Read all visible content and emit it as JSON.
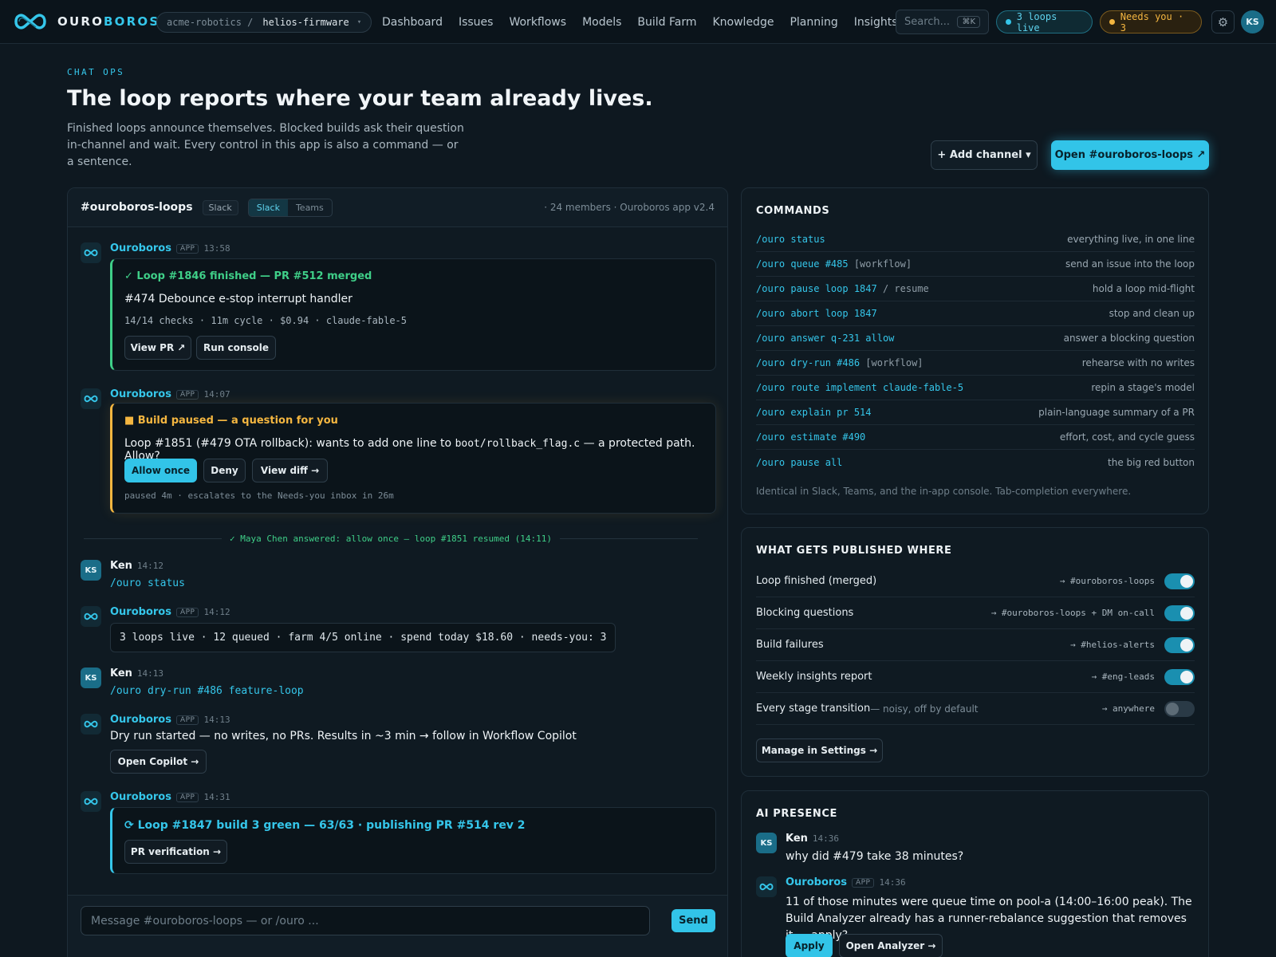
{
  "topbar": {
    "brand_a": "OURO",
    "brand_b": "BOROS",
    "repo_org": "acme-robotics /",
    "repo_name": "helios-firmware",
    "nav": [
      "Dashboard",
      "Issues",
      "Workflows",
      "Models",
      "Build Farm",
      "Knowledge",
      "Planning",
      "Insights"
    ],
    "search_placeholder": "Search...",
    "search_kbd": "⌘K",
    "live_pill": "3 loops live",
    "needs_pill": "Needs you · 3",
    "gear": "⚙",
    "avatar": "KS"
  },
  "hero": {
    "eyebrow": "CHAT OPS",
    "title": "The loop reports where your team already lives.",
    "description": "Finished loops announce themselves. Blocked builds ask their question in-channel and wait. Every control in this app is also a command — or a sentence.",
    "add_channel": "+ Add channel ▾",
    "open_channel": "Open #ouroboros-loops ↗"
  },
  "chat": {
    "channel": "#ouroboros-loops",
    "platform_tag": "Slack",
    "seg": [
      "Slack",
      "Teams"
    ],
    "meta": "· 24 members · Ouroboros app v2.4",
    "app_name": "Ouroboros",
    "app_tag": "APP",
    "messages": [
      {
        "time": "13:58",
        "title": "✓ Loop #1846 finished — PR #512 merged",
        "line1": "#474 Debounce e-stop interrupt handler",
        "line2": "14/14 checks · 11m cycle · $0.94 · claude-fable-5",
        "btn1": "View PR ↗",
        "btn2": "Run console"
      },
      {
        "time": "14:07",
        "title": "■ Build paused — a question for you",
        "body_a": "Loop #1851 (#479 OTA rollback): wants to add one line to ",
        "body_code": "boot/rollback_flag.c",
        "body_b": " — a protected path. Allow?",
        "btn1": "Allow once",
        "btn2": "Deny",
        "btn3": "View diff →",
        "foot": "paused 4m · escalates to the Needs-you inbox in 26m"
      },
      {
        "note": "✓ Maya Chen answered: allow once — loop #1851 resumed (14:11)"
      },
      {
        "sender": "Ken",
        "avatar": "KS",
        "time": "14:12",
        "text": "/ouro status"
      },
      {
        "time": "14:12",
        "text": "3 loops live · 12 queued · farm 4/5 online · spend today $18.60 · needs-you: 3"
      },
      {
        "sender": "Ken",
        "avatar": "KS",
        "time": "14:13",
        "text": "/ouro dry-run #486 feature-loop"
      },
      {
        "time": "14:13",
        "text": "Dry run started — no writes, no PRs. Results in ~3 min → follow in Workflow Copilot",
        "btn1": "Open Copilot →"
      },
      {
        "time": "14:31",
        "title": "⟳ Loop #1847 build 3 green — 63/63 · publishing PR #514 rev 2",
        "btn1": "PR verification →"
      }
    ],
    "compose_placeholder": "Message #ouroboros-loops — or /ouro ...",
    "send": "Send"
  },
  "commands": {
    "title": "COMMANDS",
    "rows": [
      {
        "cmd": "/ouro status",
        "arg": "",
        "desc": "everything live, in one line"
      },
      {
        "cmd": "/ouro queue #485 ",
        "arg": "[workflow]",
        "desc": "send an issue into the loop"
      },
      {
        "cmd": "/ouro pause loop 1847 ",
        "arg": "/ resume",
        "desc": "hold a loop mid-flight"
      },
      {
        "cmd": "/ouro abort loop 1847",
        "arg": "",
        "desc": "stop and clean up"
      },
      {
        "cmd": "/ouro answer q-231 allow",
        "arg": "",
        "desc": "answer a blocking question"
      },
      {
        "cmd": "/ouro dry-run #486 ",
        "arg": "[workflow]",
        "desc": "rehearse with no writes"
      },
      {
        "cmd": "/ouro route implement claude-fable-5",
        "arg": "",
        "desc": "repin a stage's model"
      },
      {
        "cmd": "/ouro explain pr 514",
        "arg": "",
        "desc": "plain-language summary of a PR"
      },
      {
        "cmd": "/ouro estimate #490",
        "arg": "",
        "desc": "effort, cost, and cycle guess"
      },
      {
        "cmd": "/ouro pause all",
        "arg": "",
        "desc": "the big red button"
      }
    ],
    "footnote": "Identical in Slack, Teams, and the in-app console. Tab-completion everywhere."
  },
  "publish": {
    "title": "WHAT GETS PUBLISHED WHERE",
    "rows": [
      {
        "label": "Loop finished (merged)",
        "note": "",
        "dest": "→ #ouroboros-loops",
        "on": true
      },
      {
        "label": "Blocking questions",
        "note": "",
        "dest": "→ #ouroboros-loops + DM on-call",
        "on": true
      },
      {
        "label": "Build failures",
        "note": "",
        "dest": "→ #helios-alerts",
        "on": true
      },
      {
        "label": "Weekly insights report",
        "note": "",
        "dest": "→ #eng-leads",
        "on": true
      },
      {
        "label": "Every stage transition",
        "note": " — noisy, off by default",
        "dest": "→ anywhere",
        "on": false
      }
    ],
    "manage": "Manage in Settings →"
  },
  "presence": {
    "title": "AI PRESENCE",
    "q_sender": "Ken",
    "q_avatar": "KS",
    "q_time": "14:36",
    "q_text": "why did #479 take 38 minutes?",
    "a_time": "14:36",
    "a_text": "11 of those minutes were queue time on pool-a (14:00–16:00 peak). The Build Analyzer already has a runner-rebalance suggestion that removes it — apply?",
    "btn_apply": "Apply",
    "btn_open": "Open Analyzer →"
  },
  "colors": {
    "accent": "#35c6ea",
    "success": "#3fcf88",
    "warning": "#f4b640",
    "bg": "#0e1820"
  }
}
